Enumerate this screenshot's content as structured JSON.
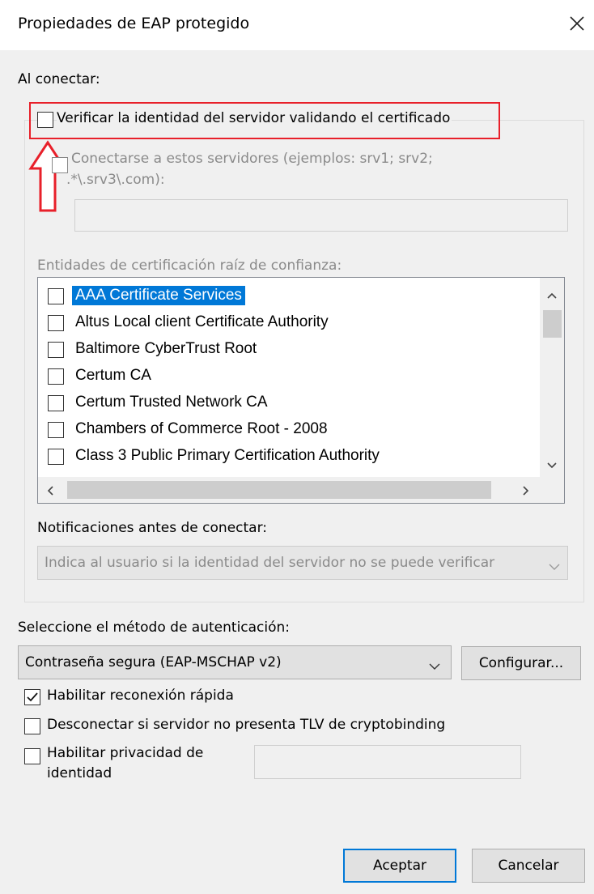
{
  "window": {
    "title": "Propiedades de EAP protegido"
  },
  "connect": {
    "label": "Al conectar:",
    "verify_cert_label": "Verificar la identidad del servidor validando el certificado",
    "servers_label_line1": "Conectarse a estos servidores (ejemplos: srv1; srv2;",
    "servers_label_line2": ".*\\.srv3\\.com):",
    "servers_value": "",
    "trusted_ca_label": "Entidades de certificación raíz de confianza:",
    "ca_list": [
      {
        "label": "AAA Certificate Services",
        "checked": false,
        "selected": true
      },
      {
        "label": "Altus Local client Certificate Authority",
        "checked": false,
        "selected": false
      },
      {
        "label": "Baltimore CyberTrust Root",
        "checked": false,
        "selected": false
      },
      {
        "label": "Certum CA",
        "checked": false,
        "selected": false
      },
      {
        "label": "Certum Trusted Network CA",
        "checked": false,
        "selected": false
      },
      {
        "label": "Chambers of Commerce Root - 2008",
        "checked": false,
        "selected": false
      },
      {
        "label": "Class 3 Public Primary Certification Authority",
        "checked": false,
        "selected": false
      }
    ],
    "notifications_label": "Notificaciones antes de conectar:",
    "notifications_value": "Indica al usuario si la identidad del servidor no se puede verificar"
  },
  "auth": {
    "label": "Seleccione el método de autenticación:",
    "method_value": "Contraseña segura (EAP-MSCHAP v2)",
    "configure_button": "Configurar...",
    "fast_reconnect_label": "Habilitar reconexión rápida",
    "fast_reconnect_checked": true,
    "disconnect_tlv_label": "Desconectar si servidor no presenta TLV de cryptobinding",
    "privacy_label_line1": "Habilitar privacidad de",
    "privacy_label_line2": "identidad",
    "privacy_value": ""
  },
  "buttons": {
    "ok": "Aceptar",
    "cancel": "Cancelar"
  },
  "colors": {
    "highlight_red": "#e8202a",
    "selection_blue": "#0078d7",
    "dialog_bg": "#f0f0f0"
  }
}
